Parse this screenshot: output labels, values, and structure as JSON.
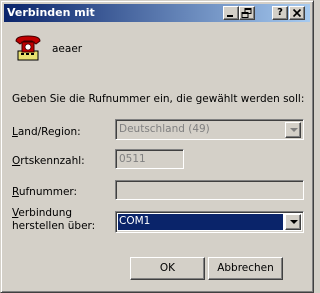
{
  "window": {
    "title": "Verbinden mit"
  },
  "titlebar": {
    "help_label": "?",
    "close_label": "X"
  },
  "connection": {
    "name": "aeaer"
  },
  "instruction": "Geben Sie die Rufnummer ein, die gewählt werden soll:",
  "form": {
    "country": {
      "label_first": "L",
      "label_rest": "and/Region:",
      "value": "Deutschland (49)"
    },
    "area_code": {
      "label_first": "O",
      "label_rest": "rtskennzahl:",
      "value": "0511"
    },
    "phone": {
      "label_first": "R",
      "label_rest": "ufnummer:",
      "value": ""
    },
    "connect_via": {
      "label_line1_first": "V",
      "label_line1_rest": "erbindung",
      "label_line2": "herstellen über:",
      "value": "COM1"
    }
  },
  "buttons": {
    "ok": "OK",
    "cancel": "Abbrechen"
  },
  "icons": [
    "phone-icon",
    "minimize-icon",
    "restore-icon",
    "help-icon",
    "close-icon",
    "dropdown-arrow-icon"
  ]
}
